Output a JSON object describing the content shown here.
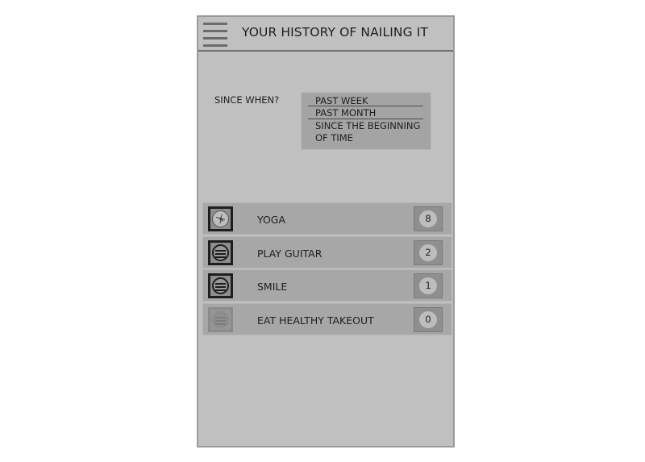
{
  "header": {
    "title": "YOUR HISTORY OF NAILING IT"
  },
  "filter": {
    "label": "SINCE WHEN?",
    "options": [
      "PAST WEEK",
      "PAST MONTH",
      "SINCE THE BEGINNING OF TIME"
    ]
  },
  "habits": [
    {
      "name": "YOGA",
      "count": "8",
      "icon": "yoga-icon"
    },
    {
      "name": "PLAY GUITAR",
      "count": "2",
      "icon": "habit-icon"
    },
    {
      "name": "SMILE",
      "count": "1",
      "icon": "habit-icon"
    },
    {
      "name": "EAT HEALTHY TAKEOUT",
      "count": "0",
      "icon": "habit-icon-inactive"
    }
  ],
  "colors": {
    "screen_bg": "#c0c0c0",
    "row_bg": "#a7a7a7",
    "badge_bg": "#8f8f8f",
    "text": "#1e1e1e"
  }
}
